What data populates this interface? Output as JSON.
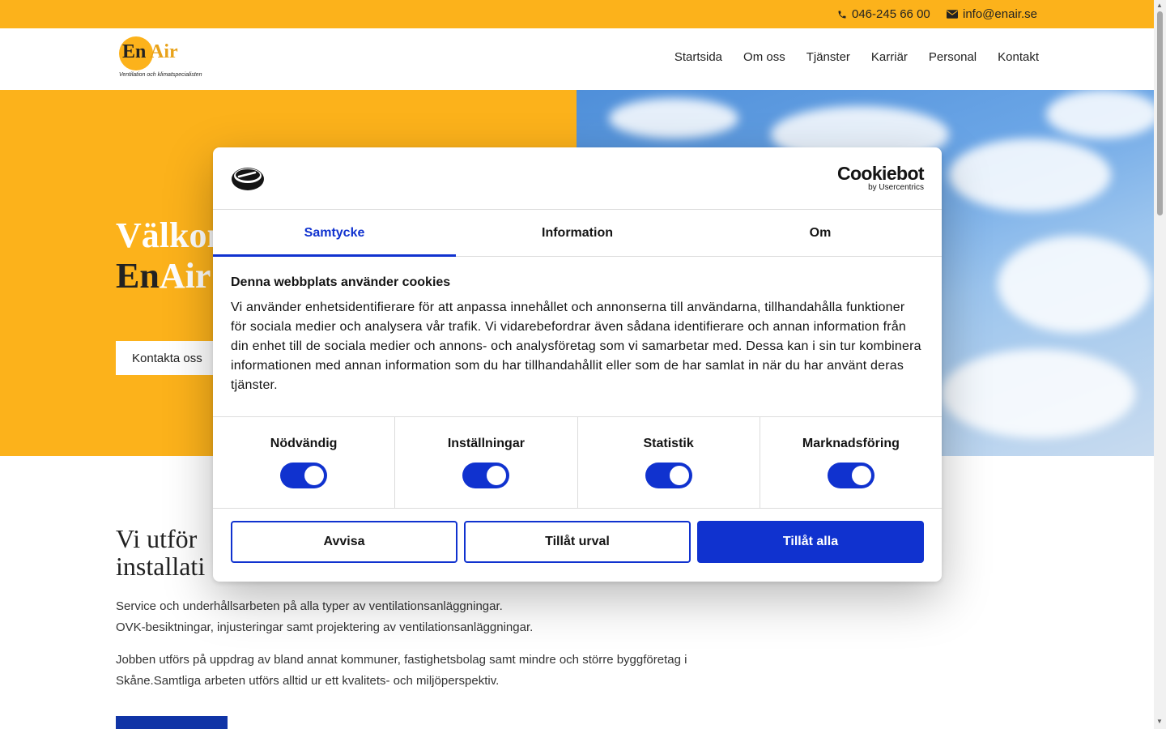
{
  "topbar": {
    "phone": "046-245 66 00",
    "email": "info@enair.se"
  },
  "logo": {
    "part1": "En",
    "part2": "Air",
    "tagline": "Ventilation och klimatspecialisten"
  },
  "nav": {
    "items": [
      "Startsida",
      "Om oss",
      "Tjänster",
      "Karriär",
      "Personal",
      "Kontakt"
    ]
  },
  "hero": {
    "title_line1": "Välkom",
    "title_line2_part1": "En",
    "title_line2_part2": "Air",
    "button_label": "Kontakta oss"
  },
  "content": {
    "title_line1": "Vi utför",
    "title_line2": "installati",
    "paragraph1_line1": "Service och underhållsarbeten på alla typer av ventilationsanläggningar.",
    "paragraph1_line2": "OVK-besiktningar, injusteringar samt projektering av ventilationsanläggningar.",
    "paragraph2": "Jobben utförs på uppdrag av bland annat kommuner, fastighetsbolag samt mindre och större byggföretag i Skåne.Samtliga arbeten utförs alltid ur ett kvalitets- och miljöperspektiv."
  },
  "cookie": {
    "brand_name": "Cookiebot",
    "brand_sub": "by Usercentrics",
    "tabs": [
      "Samtycke",
      "Information",
      "Om"
    ],
    "heading": "Denna webbplats använder cookies",
    "description": "Vi använder enhetsidentifierare för att anpassa innehållet och annonserna till användarna, tillhandahålla funktioner för sociala medier och analysera vår trafik. Vi vidarebefordrar även sådana identifierare och annan information från din enhet till de sociala medier och annons- och analysföretag som vi samarbetar med. Dessa kan i sin tur kombinera informationen med annan information som du har tillhandahållit eller som de har samlat in när du har använt deras tjänster.",
    "categories": [
      "Nödvändig",
      "Inställningar",
      "Statistik",
      "Marknadsföring"
    ],
    "buttons": {
      "reject": "Avvisa",
      "allow_selection": "Tillåt urval",
      "allow_all": "Tillåt alla"
    }
  },
  "colors": {
    "brand_yellow": "#fcb21b",
    "cookie_blue": "#1032cf",
    "content_button_blue": "#1034a6"
  }
}
